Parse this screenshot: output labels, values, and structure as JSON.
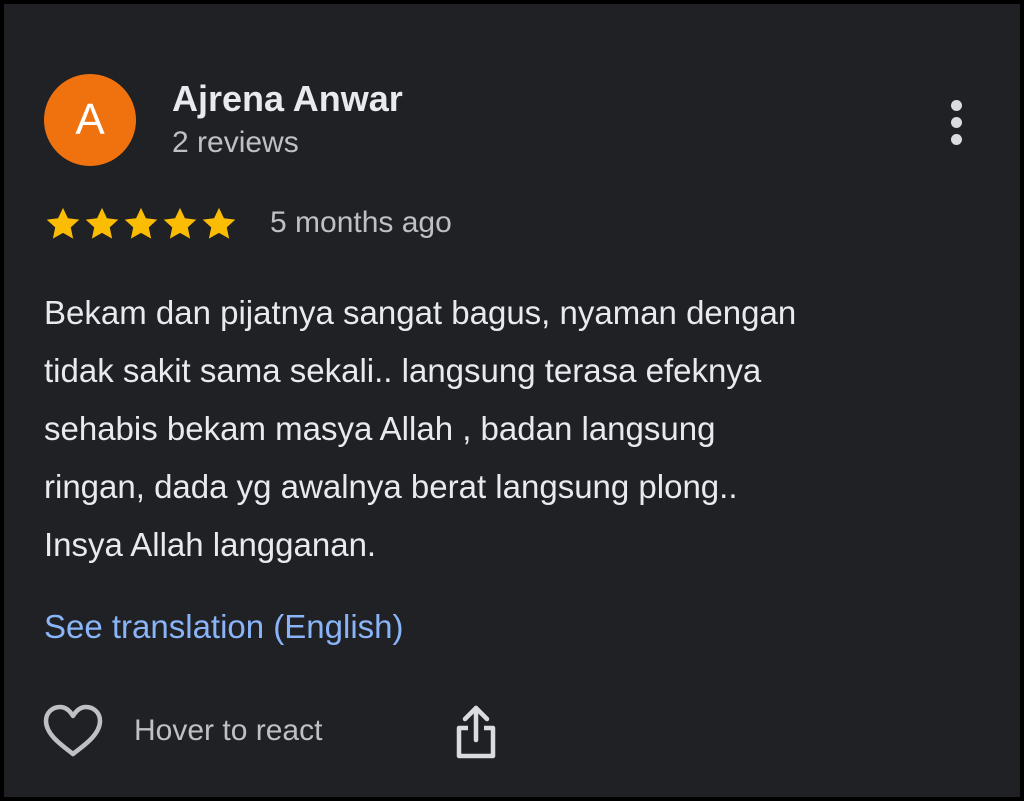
{
  "reviewer": {
    "avatar_letter": "A",
    "avatar_color": "#f0720f",
    "name": "Ajrena Anwar",
    "review_count": "2 reviews"
  },
  "menu": {
    "icon": "more-vert-icon"
  },
  "review": {
    "rating": 5,
    "rating_max": 5,
    "star_color": "#fbbc04",
    "time_ago": "5 months ago",
    "text_lines": [
      "Bekam dan pijatnya sangat bagus, nyaman dengan",
      "tidak sakit sama sekali.. langsung terasa efeknya",
      "sehabis bekam masya Allah , badan langsung",
      "ringan, dada yg awalnya berat langsung plong..",
      "Insya Allah langganan."
    ],
    "translation_link": "See translation (English)",
    "link_color": "#8ab4f8"
  },
  "actions": {
    "react_icon": "heart-icon",
    "react_label": "Hover to react",
    "share_icon": "share-icon"
  }
}
